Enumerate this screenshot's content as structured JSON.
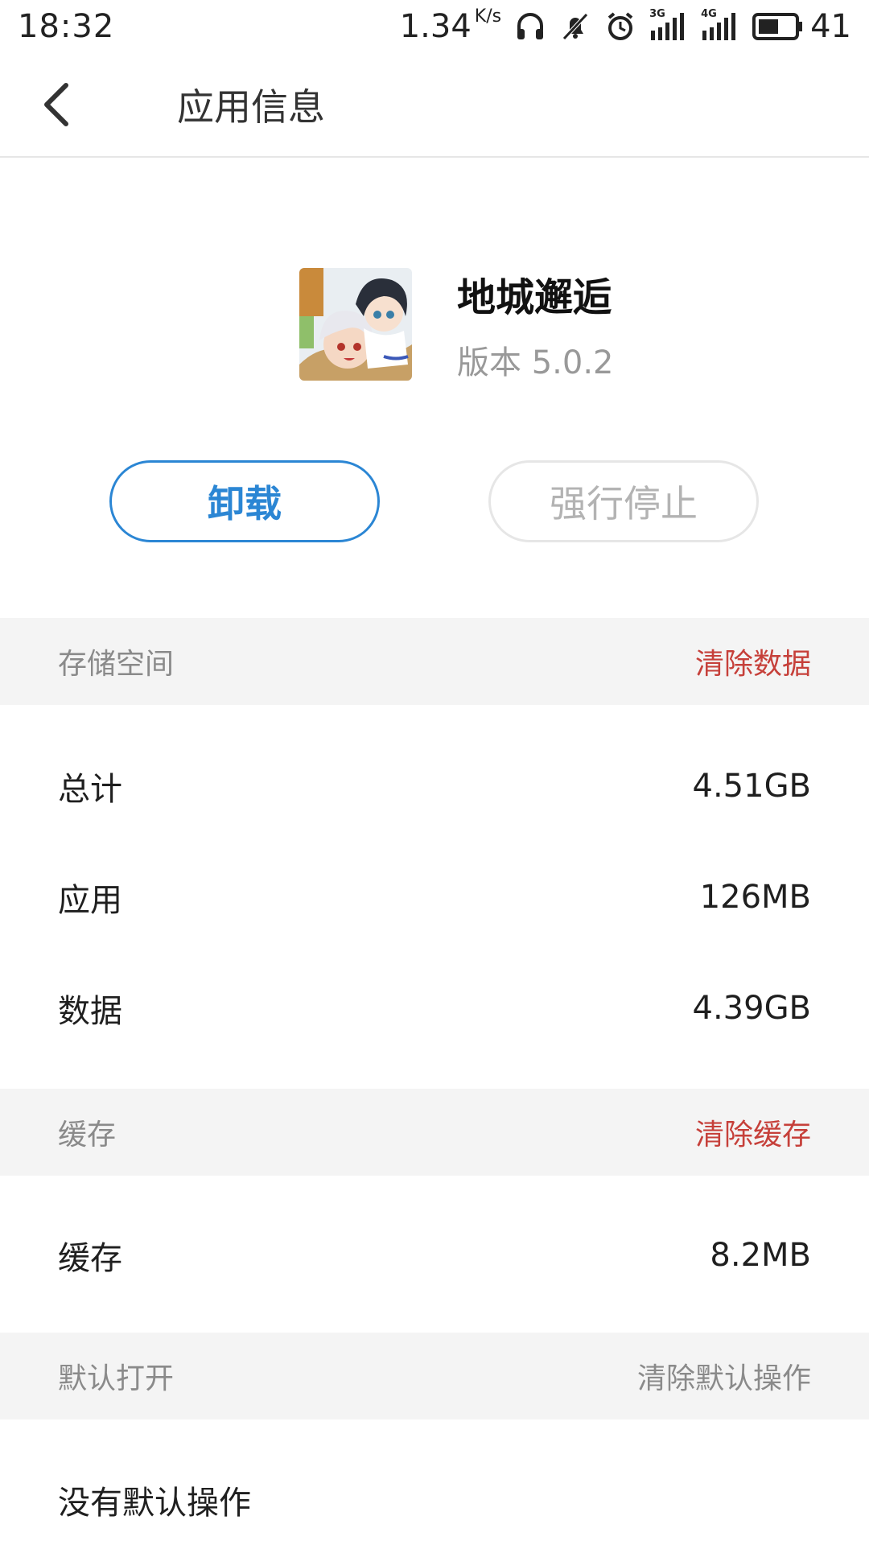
{
  "status_bar": {
    "time": "18:32",
    "speed": "1.34",
    "speed_unit": "K/s",
    "battery_level": "41",
    "network_1": "3G",
    "network_2": "4G",
    "icons": [
      "headphones-icon",
      "mute-bell-icon",
      "alarm-icon",
      "signal-3g-icon",
      "signal-4g-icon",
      "battery-icon"
    ]
  },
  "header": {
    "title": "应用信息"
  },
  "app": {
    "name": "地城邂逅",
    "version": "版本 5.0.2"
  },
  "actions": {
    "uninstall": "卸载",
    "force_stop": "强行停止"
  },
  "storage": {
    "title": "存储空间",
    "action": "清除数据",
    "rows": [
      {
        "label": "总计",
        "value": "4.51GB"
      },
      {
        "label": "应用",
        "value": "126MB"
      },
      {
        "label": "数据",
        "value": "4.39GB"
      }
    ]
  },
  "cache": {
    "title": "缓存",
    "action": "清除缓存",
    "rows": [
      {
        "label": "缓存",
        "value": "8.2MB"
      }
    ]
  },
  "defaults": {
    "title": "默认打开",
    "action": "清除默认操作",
    "rows": [
      {
        "label": "没有默认操作"
      }
    ]
  },
  "colors": {
    "accent_blue": "#2b86d4",
    "danger_red": "#c6403a",
    "section_bg": "#f4f4f4"
  }
}
